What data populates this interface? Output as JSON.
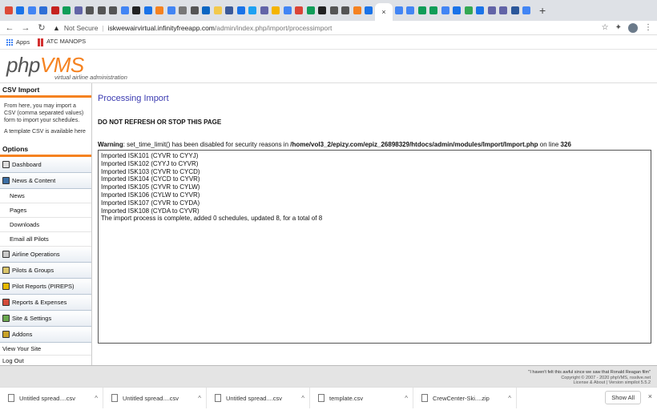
{
  "browser": {
    "tab_colors": [
      "#dc4a38",
      "#1a73e8",
      "#4285f4",
      "#2f6fd6",
      "#c5221f",
      "#0f9d58",
      "#6264a7",
      "#555555",
      "#555555",
      "#555555",
      "#4285f4",
      "#222222",
      "#1a73e8",
      "#f58220",
      "#4285f4",
      "#777777",
      "#555555",
      "#0a66c2",
      "#f2c94c",
      "#3b5998",
      "#1a73e8",
      "#1da1f2",
      "#6264a7",
      "#f4b400",
      "#4285f4",
      "#db4437",
      "#0f9d58",
      "#222222",
      "#555555",
      "#555555",
      "#f58220",
      "#1a73e8"
    ],
    "tab_colors_right": [
      "#4285f4",
      "#4285f4",
      "#0f9d58",
      "#0f9d58",
      "#4285f4",
      "#1a73e8",
      "#34a853",
      "#1a73e8",
      "#6264a7",
      "#6264a7",
      "#2b579a",
      "#4285f4"
    ],
    "active_tab_icon": "close-icon",
    "active_tab_glyph": "×",
    "new_tab_glyph": "+",
    "back_glyph": "←",
    "forward_glyph": "→",
    "reload_glyph": "↻",
    "security_label": "Not Secure",
    "url_host": "iskwewairvirtual.infinityfreeapp.com",
    "url_path": "/admin/index.php/import/processimport",
    "star_glyph": "☆",
    "extension_glyph": "✦",
    "menu_glyph": "⋮",
    "bookmarks": {
      "apps_label": "Apps",
      "atc_label": "ATC MANOPS"
    }
  },
  "header": {
    "logo_php": "php",
    "logo_vms": "VMS",
    "tagline": "virtual airline administration"
  },
  "sidebar": {
    "csv_title": "CSV Import",
    "csv_description": "From here, you may import a CSV (comma separated values) form to import your schedules.",
    "template_prefix": "A template CSV is available ",
    "template_link": "here",
    "options_title": "Options",
    "dashboard": "Dashboard",
    "news_content": "News & Content",
    "news": "News",
    "pages": "Pages",
    "downloads": "Downloads",
    "email_pilots": "Email all Pilots",
    "airline_ops": "Airline Operations",
    "pilots_groups": "Pilots & Groups",
    "pireps": "Pilot Reports (PIREPS)",
    "reports_expenses": "Reports & Expenses",
    "site_settings": "Site & Settings",
    "addons": "Addons",
    "view_site": "View Your Site",
    "logout": "Log Out"
  },
  "content": {
    "title": "Processing Import",
    "do_not_refresh": "DO NOT REFRESH OR STOP THIS PAGE",
    "warning_label": "Warning",
    "warning_text": ": set_time_limit() has been disabled for security reasons in ",
    "warning_path": "/home/vol3_2/epizy.com/epiz_26898329/htdocs/admin/modules/Import/Import.php",
    "warning_online": " on line ",
    "warning_line": "326",
    "log": [
      "Imported ISK101 (CYVR to CYYJ)",
      "Imported ISK102 (CYYJ to CYVR)",
      "Imported ISK103 (CYVR to CYCD)",
      "Imported ISK104 (CYCD to CYVR)",
      "Imported ISK105 (CYVR to CYLW)",
      "Imported ISK106 (CYLW to CYVR)",
      "Imported ISK107 (CYVR to CYDA)",
      "Imported ISK108 (CYDA to CYVR)",
      "The import process is complete, added 0 schedules, updated 8, for a total of 8"
    ]
  },
  "footer": {
    "quote": "\"I haven't felt this awful since we saw that Ronald Reagan film\"",
    "copyright": "Copyright © 2007 - 2020 phpVMS, nsslive.net",
    "version": "License & About | Version simpilot 5.5.2"
  },
  "downloads": {
    "items": [
      "Untitled spread....csv",
      "Untitled spread....csv",
      "Untitled spread....csv",
      "template.csv",
      "CrewCenter-Ski....zip"
    ],
    "chevron_glyph": "^",
    "show_all": "Show All",
    "close_glyph": "×"
  }
}
